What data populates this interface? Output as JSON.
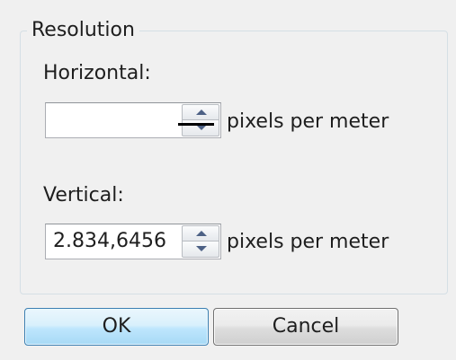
{
  "resolution": {
    "title": "Resolution",
    "horizontal": {
      "label": "Horizontal:",
      "value": "",
      "units": "pixels per meter"
    },
    "vertical": {
      "label": "Vertical:",
      "value": "2.834,6456",
      "units": "pixels per meter"
    }
  },
  "buttons": {
    "ok": "OK",
    "cancel": "Cancel"
  },
  "icons": {
    "spin_up": "spin-up-arrow-icon",
    "spin_down": "spin-down-arrow-icon",
    "text_cursor": "text-cursor-icon"
  },
  "colors": {
    "background": "#f0f0f0",
    "ok_button_border": "#3c7fb1",
    "group_border": "#d5dfe5"
  }
}
